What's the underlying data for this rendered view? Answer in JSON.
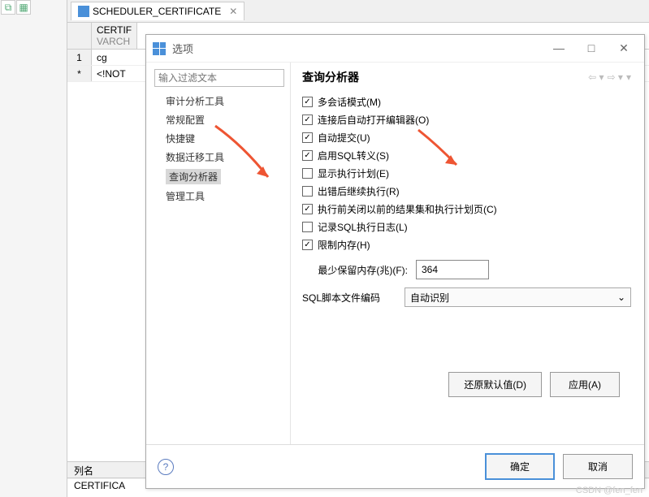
{
  "tab": {
    "title": "SCHEDULER_CERTIFICATE"
  },
  "grid": {
    "col_name": "CERTIF",
    "col_type": "VARCH",
    "rows": [
      {
        "num": "1",
        "val": "cg"
      },
      {
        "num": "*",
        "val": "<!NOT"
      }
    ]
  },
  "bottom": {
    "header": "列名",
    "value": "CERTIFICA"
  },
  "dialog": {
    "title": "选项",
    "filter_placeholder": "输入过滤文本",
    "tree": [
      "审计分析工具",
      "常规配置",
      "快捷键",
      "数据迁移工具",
      "查询分析器",
      "管理工具"
    ],
    "section_title": "查询分析器",
    "checkboxes": [
      {
        "label": "多会话模式(M)",
        "checked": true
      },
      {
        "label": "连接后自动打开编辑器(O)",
        "checked": true
      },
      {
        "label": "自动提交(U)",
        "checked": true
      },
      {
        "label": "启用SQL转义(S)",
        "checked": true
      },
      {
        "label": "显示执行计划(E)",
        "checked": false
      },
      {
        "label": "出错后继续执行(R)",
        "checked": false
      },
      {
        "label": "执行前关闭以前的结果集和执行计划页(C)",
        "checked": true
      },
      {
        "label": "记录SQL执行日志(L)",
        "checked": false
      },
      {
        "label": "限制内存(H)",
        "checked": true
      }
    ],
    "mem_label": "最少保留内存(兆)(F):",
    "mem_value": "364",
    "enc_label": "SQL脚本文件编码",
    "enc_value": "自动识别",
    "restore_btn": "还原默认值(D)",
    "apply_btn": "应用(A)",
    "ok_btn": "确定",
    "cancel_btn": "取消"
  },
  "watermark": "CSDN @fen_fen"
}
